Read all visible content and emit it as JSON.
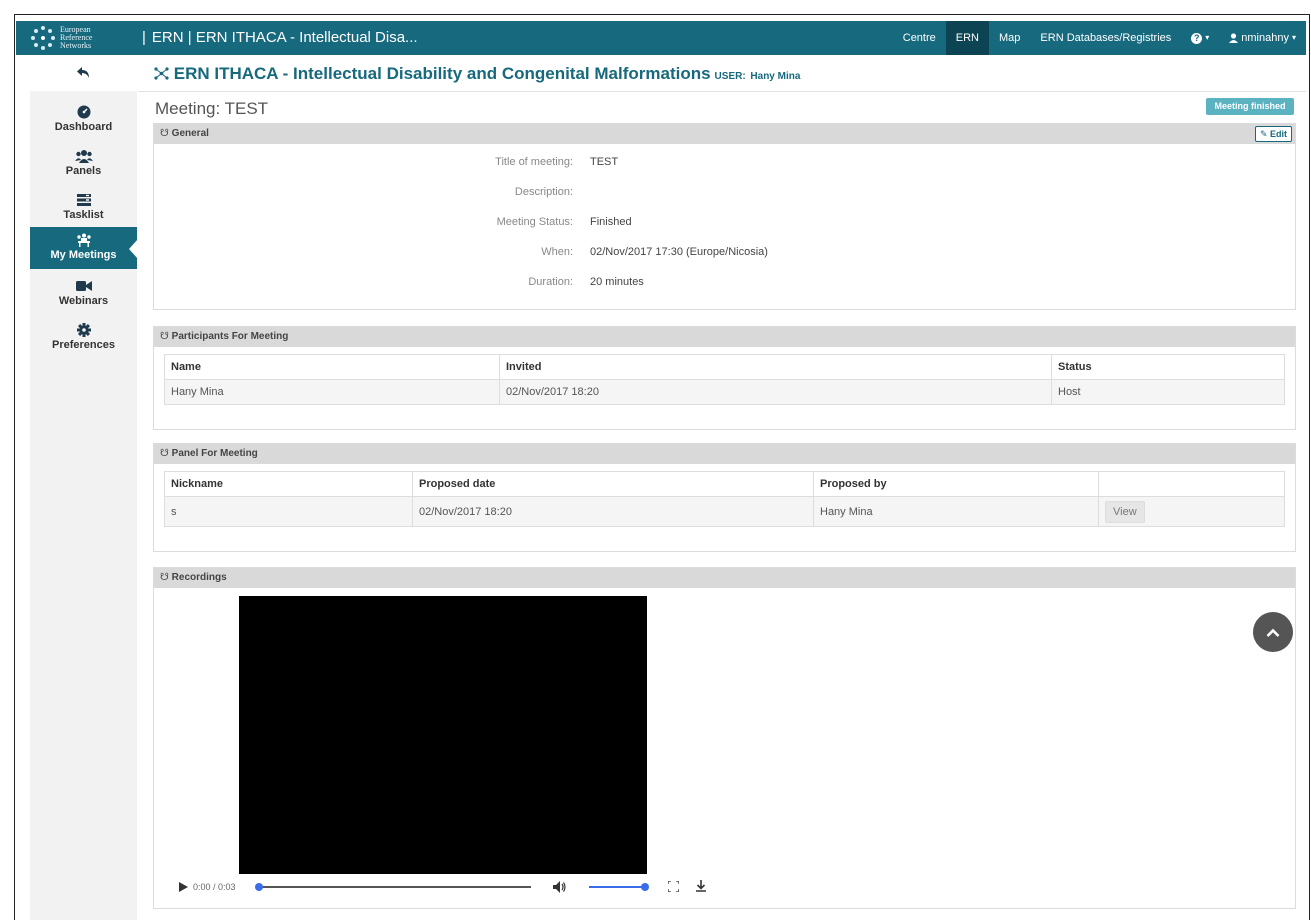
{
  "topbar": {
    "logo_text": [
      "European",
      "Reference",
      "Networks"
    ],
    "brand_sep": "|",
    "brand_title": "ERN | ERN ITHACA - Intellectual Disa...",
    "nav": [
      "Centre",
      "ERN",
      "Map",
      "ERN Databases/Registries"
    ],
    "help_label": "?",
    "user_label": "nminahny",
    "colors": {
      "bar": "#17697e",
      "active": "#0d4453"
    }
  },
  "sidebar": {
    "back_icon": "arrow-back-icon",
    "items": [
      {
        "label": "Dashboard",
        "icon": "dashboard-icon"
      },
      {
        "label": "Panels",
        "icon": "users-icon"
      },
      {
        "label": "Tasklist",
        "icon": "list-icon"
      },
      {
        "label": "My Meetings",
        "icon": "meeting-icon",
        "active": true
      },
      {
        "label": "Webinars",
        "icon": "video-camera-icon"
      },
      {
        "label": "Preferences",
        "icon": "gear-icon"
      }
    ]
  },
  "header": {
    "title": "ERN ITHACA - Intellectual Disability and Congenital Malformations",
    "user_label": "USER:",
    "user_name": "Hany Mina"
  },
  "meeting": {
    "title": "Meeting: TEST",
    "status_badge": "Meeting finished",
    "badge_color": "#5bb3c2"
  },
  "general": {
    "heading": "General",
    "edit_label": "Edit",
    "fields": [
      {
        "label": "Title of meeting:",
        "value": "TEST"
      },
      {
        "label": "Description:",
        "value": ""
      },
      {
        "label": "Meeting Status:",
        "value": "Finished"
      },
      {
        "label": "When:",
        "value": "02/Nov/2017 17:30 (Europe/Nicosia)"
      },
      {
        "label": "Duration:",
        "value": "20 minutes"
      }
    ]
  },
  "participants": {
    "heading": "Participants For Meeting",
    "columns": [
      "Name",
      "Invited",
      "Status"
    ],
    "rows": [
      [
        "Hany Mina",
        "02/Nov/2017 18:20",
        "Host"
      ]
    ]
  },
  "panel": {
    "heading": "Panel For Meeting",
    "columns": [
      "Nickname",
      "Proposed date",
      "Proposed by",
      ""
    ],
    "rows": [
      [
        "s",
        "02/Nov/2017 18:20",
        "Hany Mina"
      ]
    ],
    "view_label": "View"
  },
  "recordings": {
    "heading": "Recordings",
    "time": "0:00 / 0:03",
    "progress": 0,
    "volume": 1
  },
  "scroll_top_icon": "chevron-up-icon"
}
